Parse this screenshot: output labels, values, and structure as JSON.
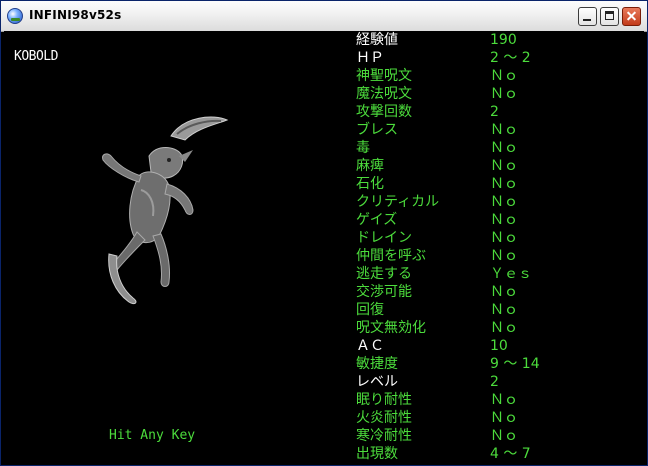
{
  "window": {
    "title": "INFINI98v52s",
    "icon": "app-globe-icon",
    "buttons": {
      "minimize": "minimize-icon",
      "maximize": "maximize-icon",
      "close": "close-icon"
    }
  },
  "game": {
    "monster_name": "KOBOLD",
    "prompt": "Hit Any Key",
    "stats": [
      {
        "label": "経験値",
        "value": "190",
        "color": "white"
      },
      {
        "label": "ＨＰ",
        "value": "2 ～ 2",
        "color": "white"
      },
      {
        "label": "神聖呪文",
        "value": "Ｎｏ",
        "color": "green"
      },
      {
        "label": "魔法呪文",
        "value": "Ｎｏ",
        "color": "green"
      },
      {
        "label": "攻撃回数",
        "value": "2",
        "color": "green"
      },
      {
        "label": "ブレス",
        "value": "Ｎｏ",
        "color": "green"
      },
      {
        "label": "毒",
        "value": "Ｎｏ",
        "color": "green"
      },
      {
        "label": "麻痺",
        "value": "Ｎｏ",
        "color": "green"
      },
      {
        "label": "石化",
        "value": "Ｎｏ",
        "color": "green"
      },
      {
        "label": "クリティカル",
        "value": "Ｎｏ",
        "color": "green"
      },
      {
        "label": "ゲイズ",
        "value": "Ｎｏ",
        "color": "green"
      },
      {
        "label": "ドレイン",
        "value": "Ｎｏ",
        "color": "green"
      },
      {
        "label": "仲間を呼ぶ",
        "value": "Ｎｏ",
        "color": "green"
      },
      {
        "label": "逃走する",
        "value": "Ｙｅｓ",
        "color": "green"
      },
      {
        "label": "交渉可能",
        "value": "Ｎｏ",
        "color": "green"
      },
      {
        "label": "回復",
        "value": "Ｎｏ",
        "color": "green"
      },
      {
        "label": "呪文無効化",
        "value": "Ｎｏ",
        "color": "green"
      },
      {
        "label": "ＡＣ",
        "value": "10",
        "color": "white"
      },
      {
        "label": "敏捷度",
        "value": "9 ～ 14",
        "color": "green"
      },
      {
        "label": "レベル",
        "value": "2",
        "color": "white"
      },
      {
        "label": "眠り耐性",
        "value": "Ｎｏ",
        "color": "green"
      },
      {
        "label": "火炎耐性",
        "value": "Ｎｏ",
        "color": "green"
      },
      {
        "label": "寒冷耐性",
        "value": "Ｎｏ",
        "color": "green"
      },
      {
        "label": "出現数",
        "value": "4 ～ 7",
        "color": "green"
      }
    ]
  },
  "colors": {
    "white": "#ffffff",
    "green": "#4cdc3c",
    "background": "#000000"
  }
}
